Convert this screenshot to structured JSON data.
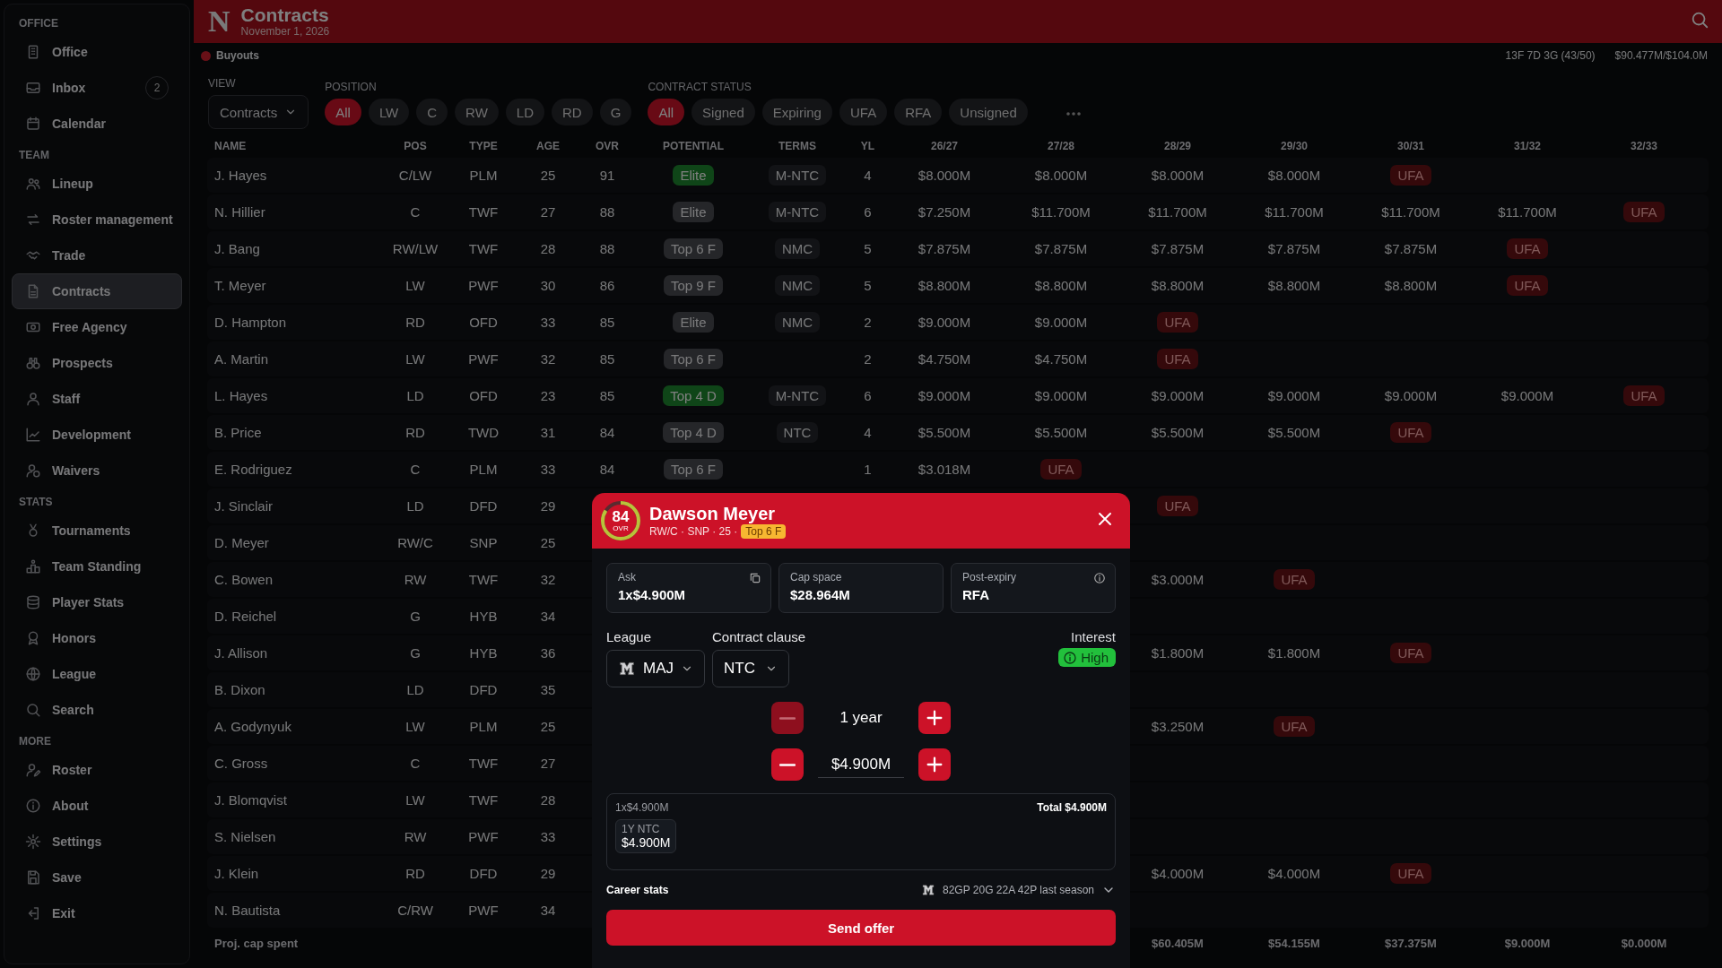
{
  "sidebar": {
    "sections": [
      {
        "title": "OFFICE",
        "items": [
          {
            "label": "Office",
            "selected": false
          },
          {
            "label": "Inbox",
            "selected": false,
            "badge": "2"
          },
          {
            "label": "Calendar",
            "selected": false
          }
        ]
      },
      {
        "title": "TEAM",
        "items": [
          {
            "label": "Lineup",
            "selected": false
          },
          {
            "label": "Roster management",
            "selected": false
          },
          {
            "label": "Trade",
            "selected": false
          },
          {
            "label": "Contracts",
            "selected": true
          },
          {
            "label": "Free Agency",
            "selected": false
          },
          {
            "label": "Prospects",
            "selected": false
          },
          {
            "label": "Staff",
            "selected": false
          },
          {
            "label": "Development",
            "selected": false
          },
          {
            "label": "Waivers",
            "selected": false
          }
        ]
      },
      {
        "title": "STATS",
        "items": [
          {
            "label": "Tournaments",
            "selected": false
          },
          {
            "label": "Team Standing",
            "selected": false
          },
          {
            "label": "Player Stats",
            "selected": false
          },
          {
            "label": "Honors",
            "selected": false
          },
          {
            "label": "League",
            "selected": false
          },
          {
            "label": "Search",
            "selected": false
          }
        ]
      },
      {
        "title": "MORE",
        "items": [
          {
            "label": "Roster",
            "selected": false
          },
          {
            "label": "About",
            "selected": false
          },
          {
            "label": "Settings",
            "selected": false
          },
          {
            "label": "Save",
            "selected": false
          },
          {
            "label": "Exit",
            "selected": false
          }
        ]
      }
    ]
  },
  "header": {
    "logo": "N",
    "title": "Contracts",
    "date": "November 1, 2026"
  },
  "subbar": {
    "legend": "Buyouts",
    "roster_count": "13F 7D 3G (43/50)",
    "cap": "$90.477M/$104.0M"
  },
  "filters": {
    "view": {
      "label": "VIEW",
      "value": "Contracts"
    },
    "position": {
      "label": "POSITION",
      "options": [
        {
          "label": "All",
          "selected": true
        },
        {
          "label": "LW",
          "selected": false
        },
        {
          "label": "C",
          "selected": false
        },
        {
          "label": "RW",
          "selected": false
        },
        {
          "label": "LD",
          "selected": false
        },
        {
          "label": "RD",
          "selected": false
        },
        {
          "label": "G",
          "selected": false
        }
      ]
    },
    "status": {
      "label": "CONTRACT STATUS",
      "options": [
        {
          "label": "All",
          "selected": true
        },
        {
          "label": "Signed",
          "selected": false
        },
        {
          "label": "Expiring",
          "selected": false
        },
        {
          "label": "UFA",
          "selected": false
        },
        {
          "label": "RFA",
          "selected": false
        },
        {
          "label": "Unsigned",
          "selected": false
        }
      ]
    }
  },
  "table": {
    "columns": [
      "NAME",
      "POS",
      "TYPE",
      "AGE",
      "OVR",
      "POTENTIAL",
      "TERMS",
      "YL",
      "26/27",
      "27/28",
      "28/29",
      "29/30",
      "30/31",
      "31/32",
      "32/33"
    ],
    "rows": [
      {
        "name": "J. Hayes",
        "pos": "C/LW",
        "type": "PLM",
        "age": "25",
        "ovr": "91",
        "potential": {
          "label": "Elite",
          "highlight": true
        },
        "terms": "M-NTC",
        "yl": "4",
        "seasons": [
          "$8.000M",
          "$8.000M",
          "$8.000M",
          "$8.000M",
          {
            "tag": "UFA"
          }
        ]
      },
      {
        "name": "N. Hillier",
        "pos": "C",
        "type": "TWF",
        "age": "27",
        "ovr": "88",
        "potential": {
          "label": "Elite",
          "highlight": false
        },
        "terms": "M-NTC",
        "yl": "6",
        "seasons": [
          "$7.250M",
          "$11.700M",
          "$11.700M",
          "$11.700M",
          "$11.700M",
          "$11.700M",
          {
            "tag": "UFA"
          }
        ]
      },
      {
        "name": "J. Bang",
        "pos": "RW/LW",
        "type": "TWF",
        "age": "28",
        "ovr": "88",
        "potential": {
          "label": "Top 6 F",
          "highlight": false
        },
        "terms": "NMC",
        "yl": "5",
        "seasons": [
          "$7.875M",
          "$7.875M",
          "$7.875M",
          "$7.875M",
          "$7.875M",
          {
            "tag": "UFA"
          }
        ]
      },
      {
        "name": "T. Meyer",
        "pos": "LW",
        "type": "PWF",
        "age": "30",
        "ovr": "86",
        "potential": {
          "label": "Top 9 F",
          "highlight": false
        },
        "terms": "NMC",
        "yl": "5",
        "seasons": [
          "$8.800M",
          "$8.800M",
          "$8.800M",
          "$8.800M",
          "$8.800M",
          {
            "tag": "UFA"
          }
        ]
      },
      {
        "name": "D. Hampton",
        "pos": "RD",
        "type": "OFD",
        "age": "33",
        "ovr": "85",
        "potential": {
          "label": "Elite",
          "highlight": false
        },
        "terms": "NMC",
        "yl": "2",
        "seasons": [
          "$9.000M",
          "$9.000M",
          {
            "tag": "UFA"
          }
        ]
      },
      {
        "name": "A. Martin",
        "pos": "LW",
        "type": "PWF",
        "age": "32",
        "ovr": "85",
        "potential": {
          "label": "Top 6 F",
          "highlight": false
        },
        "yl": "2",
        "seasons": [
          "$4.750M",
          "$4.750M",
          {
            "tag": "UFA"
          }
        ]
      },
      {
        "name": "L. Hayes",
        "pos": "LD",
        "type": "OFD",
        "age": "23",
        "ovr": "85",
        "potential": {
          "label": "Top 4 D",
          "highlight": true
        },
        "terms": "M-NTC",
        "yl": "6",
        "seasons": [
          "$9.000M",
          "$9.000M",
          "$9.000M",
          "$9.000M",
          "$9.000M",
          "$9.000M",
          {
            "tag": "UFA"
          }
        ]
      },
      {
        "name": "B. Price",
        "pos": "RD",
        "type": "TWD",
        "age": "31",
        "ovr": "84",
        "potential": {
          "label": "Top 4 D",
          "highlight": false
        },
        "terms": "NTC",
        "yl": "4",
        "seasons": [
          "$5.500M",
          "$5.500M",
          "$5.500M",
          "$5.500M",
          {
            "tag": "UFA"
          }
        ]
      },
      {
        "name": "E. Rodriguez",
        "pos": "C",
        "type": "PLM",
        "age": "33",
        "ovr": "84",
        "potential": {
          "label": "Top 6 F",
          "highlight": false
        },
        "yl": "1",
        "seasons": [
          "$3.018M",
          {
            "tag": "UFA"
          }
        ]
      },
      {
        "name": "J. Sinclair",
        "pos": "LD",
        "type": "DFD",
        "age": "29",
        "covered": true,
        "seasons": [
          {
            "tag": "UFA"
          }
        ]
      },
      {
        "name": "D. Meyer",
        "pos": "RW/C",
        "type": "SNP",
        "age": "25"
      },
      {
        "name": "C. Bowen",
        "pos": "RW",
        "type": "TWF",
        "age": "32",
        "covered": true,
        "seasons": [
          "$3.000M",
          {
            "tag": "UFA"
          }
        ]
      },
      {
        "name": "D. Reichel",
        "pos": "G",
        "type": "HYB",
        "age": "34"
      },
      {
        "name": "J. Allison",
        "pos": "G",
        "type": "HYB",
        "age": "36",
        "covered": true,
        "seasons": [
          "$1.800M",
          "$1.800M",
          {
            "tag": "UFA"
          }
        ]
      },
      {
        "name": "B. Dixon",
        "pos": "LD",
        "type": "DFD",
        "age": "35"
      },
      {
        "name": "A. Godynyuk",
        "pos": "LW",
        "type": "PLM",
        "age": "25",
        "covered": true,
        "seasons": [
          "$3.250M",
          {
            "tag": "UFA"
          }
        ]
      },
      {
        "name": "C. Gross",
        "pos": "C",
        "type": "TWF",
        "age": "27"
      },
      {
        "name": "J. Blomqvist",
        "pos": "LW",
        "type": "TWF",
        "age": "28"
      },
      {
        "name": "S. Nielsen",
        "pos": "RW",
        "type": "PWF",
        "age": "33"
      },
      {
        "name": "J. Klein",
        "pos": "RD",
        "type": "DFD",
        "age": "29",
        "covered": true,
        "seasons": [
          "$4.000M",
          "$4.000M",
          {
            "tag": "UFA"
          }
        ]
      },
      {
        "name": "N. Bautista",
        "pos": "C/RW",
        "type": "PWF",
        "age": "34"
      }
    ],
    "footer": {
      "label": "Proj. cap spent",
      "covered": true,
      "totals": [
        "$60.405M",
        "$54.155M",
        "$37.375M",
        "$9.000M",
        "$0.000M"
      ]
    }
  },
  "offer_dialog": {
    "ovr": "84",
    "ovr_label": "OVR",
    "level": 0.84,
    "name": "Dawson Meyer",
    "meta": "RW/C · SNP · 25 ·",
    "tag": "Top 6 F",
    "cards": [
      {
        "label": "Ask",
        "value": "1x$4.900M",
        "kind": "copy"
      },
      {
        "label": "Cap space",
        "value": "$28.964M",
        "kind": "plain"
      },
      {
        "label": "Post-expiry",
        "value": "RFA",
        "kind": "info"
      }
    ],
    "league": {
      "label": "League",
      "value": "MAJ"
    },
    "clause": {
      "label": "Contract clause",
      "value": "NTC"
    },
    "interest": {
      "label": "Interest",
      "value": "High"
    },
    "years": {
      "value": "1 year",
      "minus_disabled": true
    },
    "salary": {
      "value": "$4.900M",
      "minus_disabled": false
    },
    "summary": {
      "line": "1x$4.900M",
      "total": "Total $4.900M",
      "chips": [
        {
          "label": "1Y NTC",
          "value": "$4.900M"
        }
      ]
    },
    "career": {
      "label": "Career stats",
      "value": "82GP 20G 22A 42P last season"
    },
    "submit": "Send offer"
  }
}
